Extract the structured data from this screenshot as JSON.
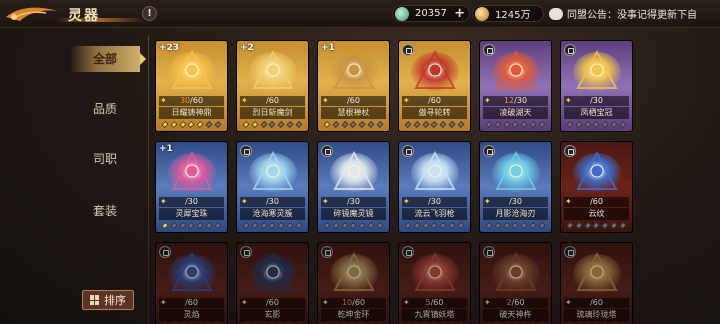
{
  "header": {
    "title": "灵器",
    "help": "!",
    "resource1": {
      "value": "20357",
      "plus": "+"
    },
    "resource2": {
      "value": "1245万"
    },
    "notice": "同盟公告：没事记得更新下自"
  },
  "sidebar": {
    "items": [
      {
        "label": "全部",
        "active": true
      },
      {
        "label": "品质",
        "active": false
      },
      {
        "label": "司职",
        "active": false
      },
      {
        "label": "套装",
        "active": false
      }
    ],
    "sort_label": "排序"
  },
  "cards": [
    {
      "name": "日耀铸神鼎",
      "progress": "30/60",
      "cur": "30",
      "max": "/60",
      "badge": "+23",
      "theme": "gold",
      "icon": "cauldron-icon",
      "color": "#f7c24a",
      "dots": 5
    },
    {
      "name": "烈日斩魔剑",
      "progress": "0/60",
      "cur": "",
      "max": "/60",
      "badge": "+2",
      "theme": "gold",
      "icon": "sword-icon",
      "color": "#f0d070",
      "dots": 2
    },
    {
      "name": "慧根禅杖",
      "progress": "/60",
      "cur": "",
      "max": "/60",
      "badge": "+1",
      "theme": "gold",
      "icon": "staff-icon",
      "color": "#c89444",
      "dots": 1
    },
    {
      "name": "傲寻轮转",
      "progress": "/60",
      "cur": "",
      "max": "/60",
      "badge": "",
      "theme": "gold",
      "icon": "scepter-icon",
      "color": "#c0362a",
      "dots": 0
    },
    {
      "name": "凌破湖天",
      "progress": "12/30",
      "cur": "12",
      "max": "/30",
      "badge": "",
      "theme": "purple",
      "icon": "spear-icon",
      "color": "#e05a3a",
      "dots": 0
    },
    {
      "name": "凤栖宝冠",
      "progress": "/30",
      "cur": "",
      "max": "/30",
      "badge": "",
      "theme": "purple",
      "icon": "crown-icon",
      "color": "#f3c64a",
      "dots": 0
    },
    {
      "name": "灵犀宝珠",
      "progress": "0/30",
      "cur": "",
      "max": "/30",
      "badge": "+1",
      "theme": "blue",
      "icon": "flower-icon",
      "color": "#e05aa0",
      "dots": 1
    },
    {
      "name": "沧海寒灵簇",
      "progress": "/30",
      "cur": "",
      "max": "/30",
      "badge": "",
      "theme": "blue",
      "icon": "shell-icon",
      "color": "#9fd6f2",
      "dots": 0
    },
    {
      "name": "碎镜魔灵镜",
      "progress": "/30",
      "cur": "",
      "max": "/30",
      "badge": "",
      "theme": "blue",
      "icon": "mirror-icon",
      "color": "#dfe8f0",
      "dots": 0
    },
    {
      "name": "流云飞羽枪",
      "progress": "/30",
      "cur": "",
      "max": "/30",
      "badge": "",
      "theme": "blue",
      "icon": "lance-icon",
      "color": "#c6e2f8",
      "dots": 0
    },
    {
      "name": "月影沧海刃",
      "progress": "/30",
      "cur": "",
      "max": "/30",
      "badge": "",
      "theme": "blue",
      "icon": "blade-icon",
      "color": "#6fd0e8",
      "dots": 0
    },
    {
      "name": "云纹",
      "progress": "0/60",
      "cur": "",
      "max": "/60",
      "badge": "",
      "theme": "red",
      "icon": "gem-icon",
      "color": "#3e6fd0",
      "dots": 0
    },
    {
      "name": "灵焰",
      "progress": "0/60",
      "cur": "",
      "max": "/60",
      "badge": "",
      "theme": "red",
      "icon": "feather-icon",
      "color": "#3554b8",
      "dots": 0
    },
    {
      "name": "玄影",
      "progress": "0/60",
      "cur": "",
      "max": "/60",
      "badge": "",
      "theme": "red",
      "icon": "trident-icon",
      "color": "#2a3a70",
      "dots": 0
    },
    {
      "name": "乾坤金环",
      "progress": "10/60",
      "cur": "10",
      "max": "/60",
      "badge": "",
      "theme": "red",
      "icon": "ring-icon",
      "color": "#b8924a",
      "dots": 0
    },
    {
      "name": "九霄镇妖塔",
      "progress": "5/60",
      "cur": "5",
      "max": "/60",
      "badge": "",
      "theme": "red",
      "icon": "pagoda-icon",
      "color": "#d0473a",
      "dots": 0
    },
    {
      "name": "破天神杵",
      "progress": "2/60",
      "cur": "2",
      "max": "/60",
      "badge": "",
      "theme": "red",
      "icon": "pestle-icon",
      "color": "#a0522d",
      "dots": 0
    },
    {
      "name": "琉璃玲珑塔",
      "progress": "0/60",
      "cur": "",
      "max": "/60",
      "badge": "",
      "theme": "red",
      "icon": "lantern-icon",
      "color": "#c8893a",
      "dots": 0
    }
  ]
}
